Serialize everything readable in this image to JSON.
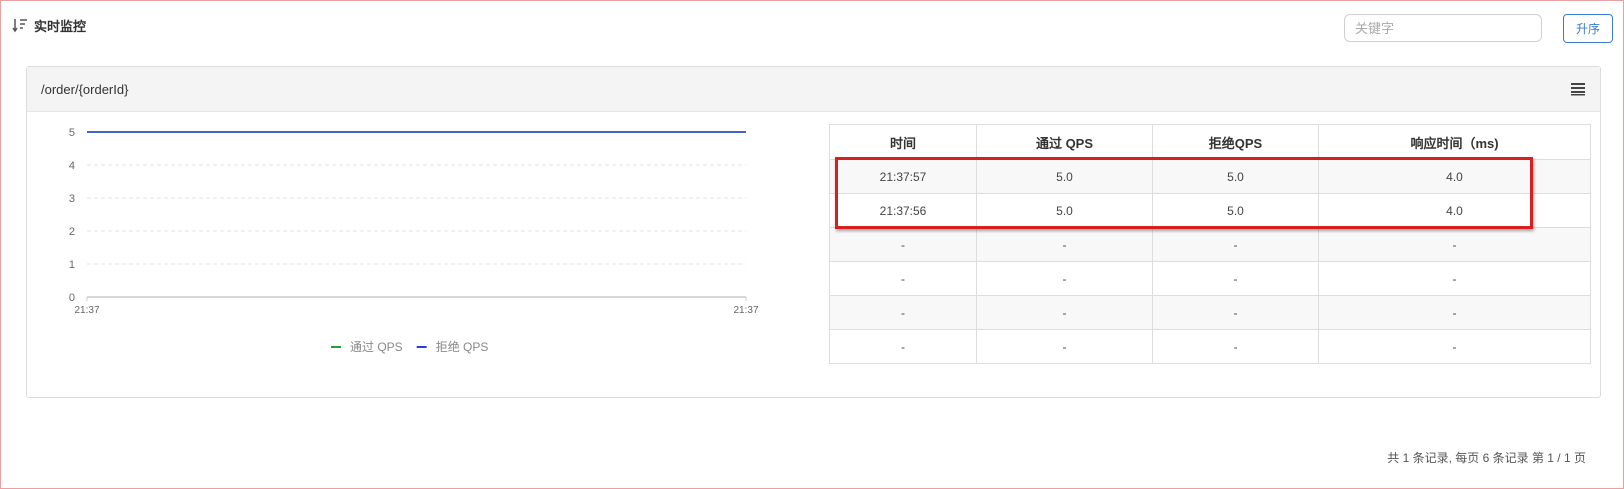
{
  "header": {
    "title": "实时监控",
    "sort_icon": "sort-descending-icon"
  },
  "search": {
    "placeholder": "关键字",
    "value": ""
  },
  "sort_button": {
    "label": "升序"
  },
  "panel": {
    "resource": "/order/{orderId}",
    "menu_icon": "hamburger-menu-icon"
  },
  "chart_data": {
    "type": "line",
    "x": [
      "21:37",
      "21:37"
    ],
    "x_tick_labels": [
      "21:37",
      "21:37"
    ],
    "ylim": [
      0,
      5
    ],
    "y_ticks": [
      0,
      1,
      2,
      3,
      4,
      5
    ],
    "grid": "horizontal-dashed",
    "legend_position": "bottom",
    "series": [
      {
        "name": "通过 QPS",
        "color": "#22a33a",
        "values": [
          5,
          5
        ]
      },
      {
        "name": "拒绝 QPS",
        "color": "#2b3fd4",
        "values": [
          5,
          5
        ]
      }
    ]
  },
  "table": {
    "columns": [
      "时间",
      "通过 QPS",
      "拒绝QPS",
      "响应时间（ms)"
    ],
    "rows": [
      [
        "21:37:57",
        "5.0",
        "5.0",
        "4.0"
      ],
      [
        "21:37:56",
        "5.0",
        "5.0",
        "4.0"
      ],
      [
        "-",
        "-",
        "-",
        "-"
      ],
      [
        "-",
        "-",
        "-",
        "-"
      ],
      [
        "-",
        "-",
        "-",
        "-"
      ],
      [
        "-",
        "-",
        "-",
        "-"
      ]
    ]
  },
  "highlight": {
    "color": "#d61f1f"
  },
  "pagination": {
    "text": "共 1 条记录, 每页 6 条记录 第 1 / 1 页"
  }
}
